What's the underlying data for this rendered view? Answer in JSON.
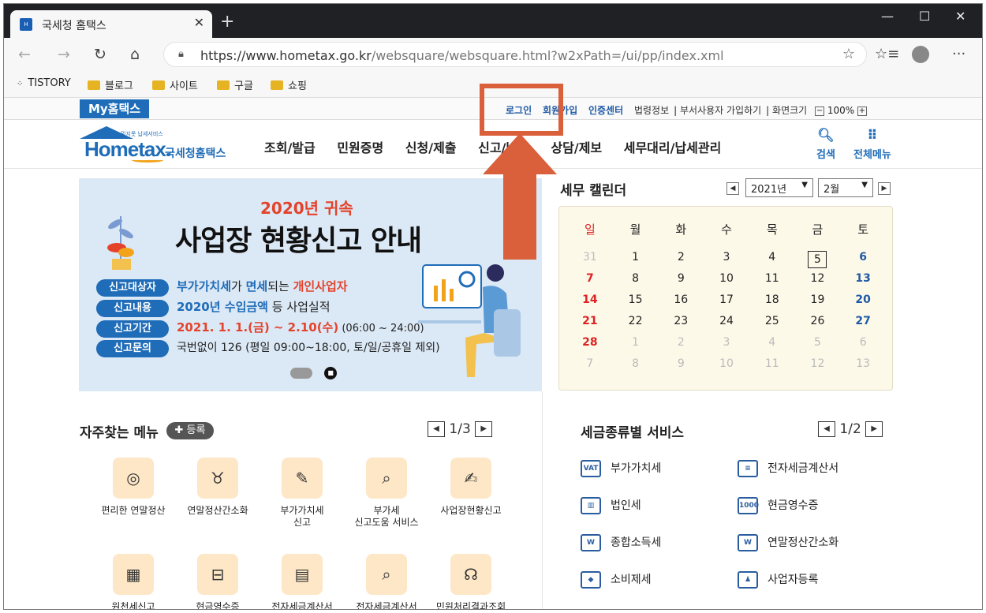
{
  "browser": {
    "tab_title": "국세청 홈택스",
    "tab_close": "✕",
    "new_tab": "+",
    "window_controls": [
      "—",
      "☐",
      "✕"
    ],
    "url_prefix": "https://www.hometax.go.kr",
    "url_rest": "/websquare/websquare.html?w2xPath=/ui/pp/index.xml",
    "bookmarks": [
      "TISTORY",
      "블로그",
      "사이트",
      "구글",
      "쇼핑"
    ]
  },
  "topbar": {
    "my": "My홈택스",
    "login": "로그인",
    "join": "회원가입",
    "cert": "인증센터",
    "law": "법령정보",
    "dept": "부서사용자 가입하기",
    "screen": "화면크기",
    "zoom": "100%"
  },
  "logo": {
    "small": "믿지못 납세서비스",
    "main": "Hometax.",
    "kr": "국세청홈택스"
  },
  "nav": [
    "조회/발급",
    "민원증명",
    "신청/제출",
    "신고/납부",
    "상담/제보",
    "세무대리/납세관리"
  ],
  "header_icons": {
    "search": "검색",
    "menu": "전체메뉴"
  },
  "banner": {
    "year": "2020년 귀속",
    "headline": "사업장 현황신고 안내",
    "rows": [
      {
        "tag": "신고대상자",
        "parts": [
          [
            "blue",
            "부가가치세"
          ],
          [
            "plain",
            "가 "
          ],
          [
            "blue",
            "면세"
          ],
          [
            "plain",
            "되는 "
          ],
          [
            "red",
            "개인사업자"
          ]
        ]
      },
      {
        "tag": "신고내용",
        "parts": [
          [
            "blue",
            "2020년 수입금액"
          ],
          [
            "plain",
            " 등 사업실적"
          ]
        ]
      },
      {
        "tag": "신고기간",
        "parts": [
          [
            "red",
            "2021. 1. 1.(금) ~ 2.10(수)"
          ],
          [
            "plain",
            " (06:00 ~ 24:00)"
          ]
        ]
      },
      {
        "tag": "신고문의",
        "parts": [
          [
            "plain",
            "국번없이 126 (평일 09:00~18:00, 토/일/공휴일 제외)"
          ]
        ]
      }
    ]
  },
  "calendar": {
    "title": "세무 캘린더",
    "year": "2021년",
    "month": "2월",
    "weekdays": [
      "일",
      "월",
      "화",
      "수",
      "목",
      "금",
      "토"
    ],
    "weeks": [
      [
        "31",
        "1",
        "2",
        "3",
        "4",
        "5",
        "6"
      ],
      [
        "7",
        "8",
        "9",
        "10",
        "11",
        "12",
        "13"
      ],
      [
        "14",
        "15",
        "16",
        "17",
        "18",
        "19",
        "20"
      ],
      [
        "21",
        "22",
        "23",
        "24",
        "25",
        "26",
        "27"
      ],
      [
        "28",
        "1",
        "2",
        "3",
        "4",
        "5",
        "6"
      ],
      [
        "7",
        "8",
        "9",
        "10",
        "11",
        "12",
        "13"
      ]
    ]
  },
  "frequent": {
    "title": "자주찾는 메뉴",
    "register": "등록",
    "page": "1/3",
    "items": [
      {
        "label": "편리한 연말정산",
        "icon": "money-bag-icon"
      },
      {
        "label": "연말정산간소화",
        "icon": "piggy-icon"
      },
      {
        "label": "부가가치세\n신고",
        "icon": "vat-doc-icon"
      },
      {
        "label": "부가세\n신고도움 서비스",
        "icon": "search-doc-icon"
      },
      {
        "label": "사업장현황신고",
        "icon": "edit-doc-icon"
      },
      {
        "label": "원천세신고",
        "icon": "calendar-edit-icon"
      },
      {
        "label": "현금영수증",
        "icon": "cash-search-icon"
      },
      {
        "label": "전자세금계산서",
        "icon": "calculator-icon"
      },
      {
        "label": "전자세금계산서",
        "icon": "invoice-search-icon"
      },
      {
        "label": "민원처리결과조회",
        "icon": "headset-icon"
      }
    ]
  },
  "taxservice": {
    "title": "세금종류별 서비스",
    "page": "1/2",
    "items": [
      {
        "label": "부가가치세",
        "icon": "VAT"
      },
      {
        "label": "전자세금계산서",
        "icon": "≡"
      },
      {
        "label": "법인세",
        "icon": "▥"
      },
      {
        "label": "현금영수증",
        "icon": "1000"
      },
      {
        "label": "종합소득세",
        "icon": "W"
      },
      {
        "label": "연말정산간소화",
        "icon": "W"
      },
      {
        "label": "소비제세",
        "icon": "◆"
      },
      {
        "label": "사업자등록",
        "icon": "♟"
      }
    ]
  },
  "colors": {
    "brand": "#1f6cb8",
    "accent_red": "#e4432b",
    "annotation": "#d9603b"
  }
}
